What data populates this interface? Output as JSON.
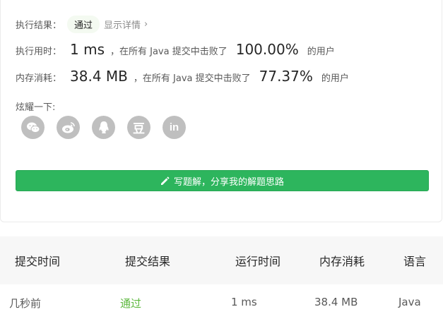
{
  "summary": {
    "status_label": "执行结果：",
    "status_value": "通过",
    "details_link": "显示详情",
    "runtime_label": "执行用时：",
    "runtime_value": "1 ms",
    "runtime_text": "，在所有 Java 提交中击败了",
    "runtime_percent": "100.00%",
    "runtime_suffix": "的用户",
    "memory_label": "内存消耗：",
    "memory_value": "38.4 MB",
    "memory_text": "，在所有 Java 提交中击败了",
    "memory_percent": "77.37%",
    "memory_suffix": "的用户",
    "share_label": "炫耀一下:",
    "share_icons": [
      "wechat-icon",
      "weibo-icon",
      "qq-icon",
      "douban-icon",
      "linkedin-icon"
    ],
    "douban_glyph": "豆",
    "linkedin_glyph": "in",
    "solution_button": "写题解，分享我的解题思路"
  },
  "submissions": {
    "headers": [
      "提交时间",
      "提交结果",
      "运行时间",
      "内存消耗",
      "语言"
    ],
    "rows": [
      {
        "time": "几秒前",
        "result": "通过",
        "runtime": "1 ms",
        "memory": "38.4 MB",
        "language": "Java"
      }
    ]
  },
  "colors": {
    "accent_green": "#2db55d",
    "pass_green": "#5cb83d",
    "icon_gray": "#bfbfbf"
  }
}
